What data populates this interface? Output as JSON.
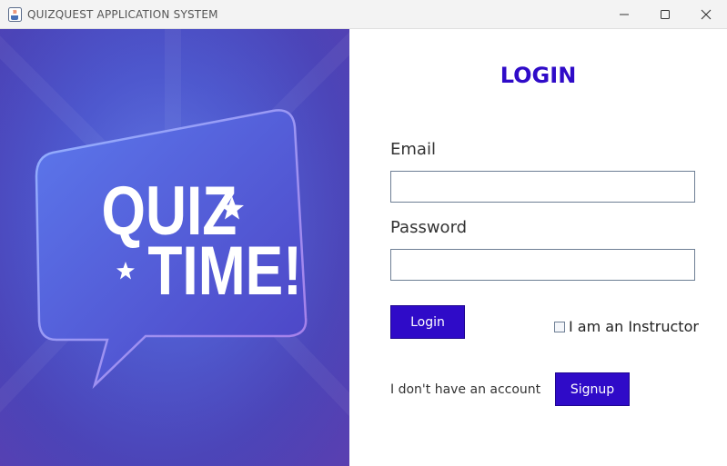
{
  "window": {
    "title": "QUIZQUEST APPLICATION SYSTEM",
    "icons": {
      "app": "java-cup-icon",
      "minimize": "minimize-icon",
      "maximize": "maximize-icon",
      "close": "close-icon"
    }
  },
  "hero": {
    "line1": "QUIZ",
    "line2": "TIME!",
    "colors": {
      "accent": "#2f0bc8",
      "background": "#4b4fc8"
    }
  },
  "login": {
    "title": "LOGIN",
    "email_label": "Email",
    "email_value": "",
    "password_label": "Password",
    "password_value": "",
    "login_button": "Login",
    "instructor_checkbox": {
      "label": "I am an Instructor",
      "checked": false
    },
    "no_account_text": "I don't have an account",
    "signup_button": "Signup"
  }
}
